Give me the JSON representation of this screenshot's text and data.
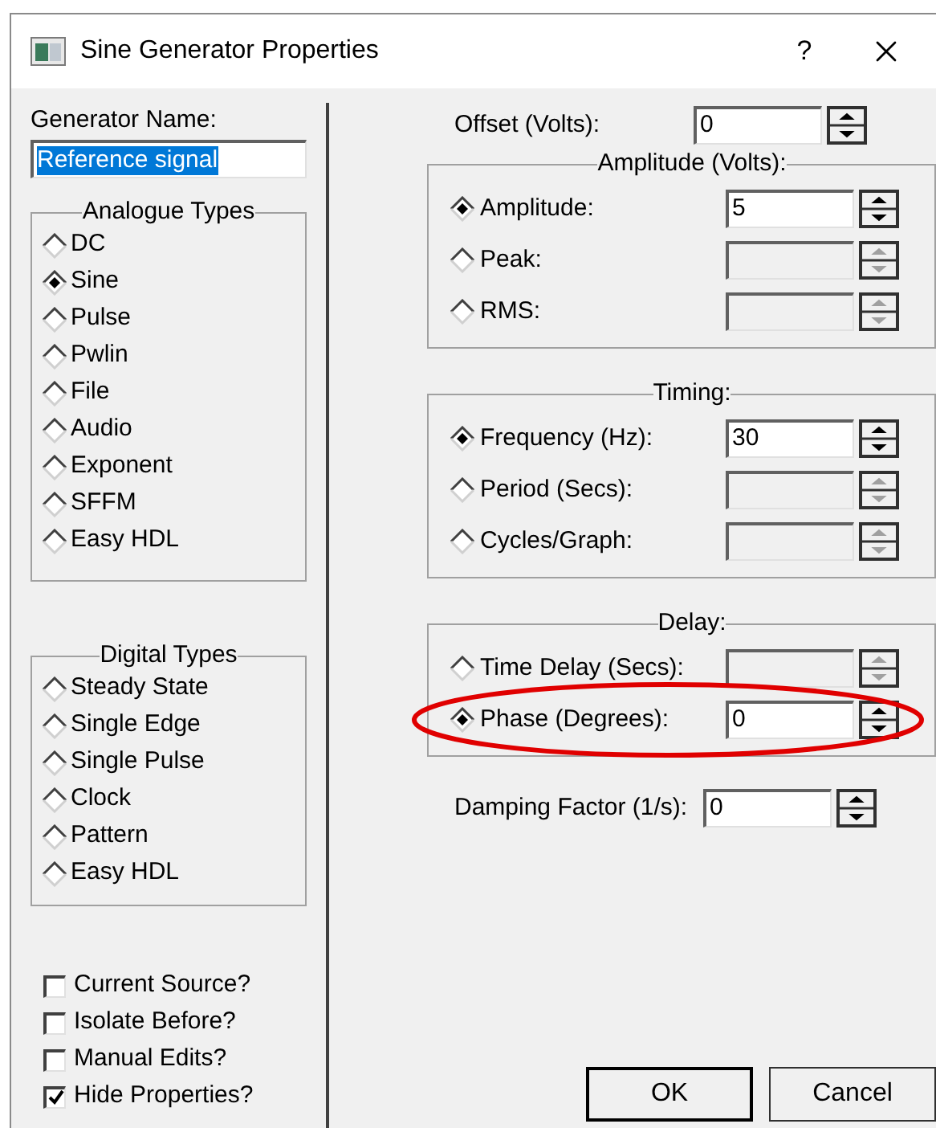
{
  "window": {
    "title": "Sine Generator Properties",
    "help": "?"
  },
  "generator_name": {
    "label": "Generator Name:",
    "value": "Reference signal",
    "selected": true
  },
  "analogue_types": {
    "title": "Analogue Types",
    "options": [
      {
        "label": "DC",
        "selected": false
      },
      {
        "label": "Sine",
        "selected": true
      },
      {
        "label": "Pulse",
        "selected": false
      },
      {
        "label": "Pwlin",
        "selected": false
      },
      {
        "label": "File",
        "selected": false
      },
      {
        "label": "Audio",
        "selected": false
      },
      {
        "label": "Exponent",
        "selected": false
      },
      {
        "label": "SFFM",
        "selected": false
      },
      {
        "label": "Easy HDL",
        "selected": false
      }
    ]
  },
  "digital_types": {
    "title": "Digital Types",
    "options": [
      {
        "label": "Steady State",
        "selected": false
      },
      {
        "label": "Single Edge",
        "selected": false
      },
      {
        "label": "Single Pulse",
        "selected": false
      },
      {
        "label": "Clock",
        "selected": false
      },
      {
        "label": "Pattern",
        "selected": false
      },
      {
        "label": "Easy HDL",
        "selected": false
      }
    ]
  },
  "checkboxes": [
    {
      "label": "Current Source?",
      "checked": false
    },
    {
      "label": "Isolate Before?",
      "checked": false
    },
    {
      "label": "Manual Edits?",
      "checked": false
    },
    {
      "label": "Hide Properties?",
      "checked": true
    }
  ],
  "offset": {
    "label": "Offset (Volts):",
    "value": "0",
    "disabled": false
  },
  "groups": [
    {
      "title": "Amplitude (Volts):",
      "rows": [
        {
          "label": "Amplitude:",
          "selected": true,
          "value": "5",
          "disabled": false
        },
        {
          "label": "Peak:",
          "selected": false,
          "disabled": true
        },
        {
          "label": "RMS:",
          "selected": false,
          "disabled": true
        }
      ]
    },
    {
      "title": "Timing:",
      "rows": [
        {
          "label": "Frequency (Hz):",
          "selected": true,
          "value": "30",
          "disabled": false
        },
        {
          "label": "Period (Secs):",
          "selected": false,
          "disabled": true
        },
        {
          "label": "Cycles/Graph:",
          "selected": false,
          "disabled": true
        }
      ]
    },
    {
      "title": "Delay:",
      "rows": [
        {
          "label": "Time Delay (Secs):",
          "selected": false,
          "disabled": true
        },
        {
          "label": "Phase (Degrees):",
          "selected": true,
          "value": "0",
          "disabled": false,
          "highlighted": true
        }
      ]
    }
  ],
  "damping": {
    "label": "Damping Factor (1/s):",
    "value": "0",
    "disabled": false
  },
  "buttons": [
    {
      "label": "OK",
      "default": true
    },
    {
      "label": "Cancel",
      "default": false
    }
  ]
}
